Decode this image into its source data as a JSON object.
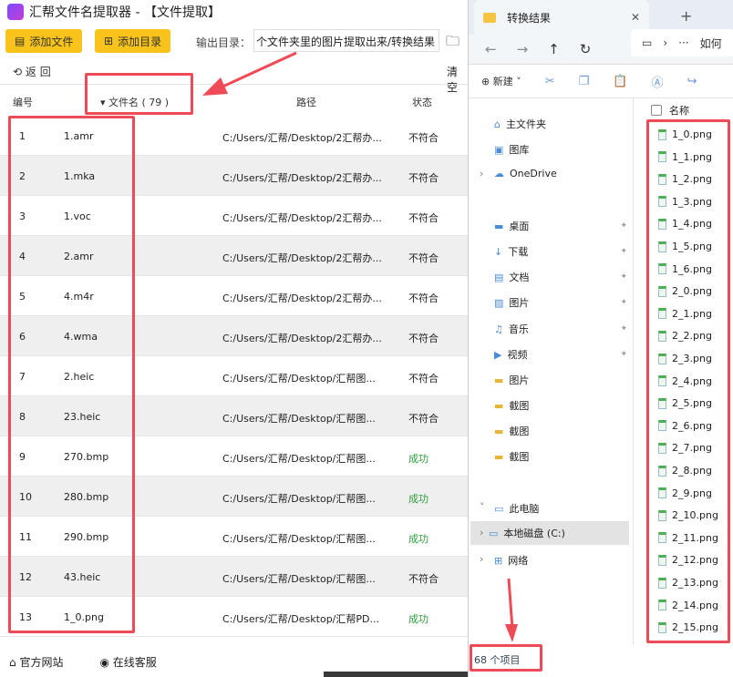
{
  "app": {
    "title": "汇帮文件名提取器 - 【文件提取】",
    "add_file": "添加文件",
    "add_dir": "添加目录",
    "output_label": "输出目录：",
    "output_value": "个文件夹里的图片提取出来/转换结果",
    "back": "返 回",
    "clear": "清空",
    "headers": {
      "num": "编号",
      "name": "▾ 文件名 ( 79 )",
      "path": "路径",
      "status": "状态"
    },
    "rows": [
      {
        "n": "1",
        "name": "1.amr",
        "path": "C:/Users/汇帮/Desktop/2汇帮办...",
        "status": "不符合"
      },
      {
        "n": "2",
        "name": "1.mka",
        "path": "C:/Users/汇帮/Desktop/2汇帮办...",
        "status": "不符合"
      },
      {
        "n": "3",
        "name": "1.voc",
        "path": "C:/Users/汇帮/Desktop/2汇帮办...",
        "status": "不符合"
      },
      {
        "n": "4",
        "name": "2.amr",
        "path": "C:/Users/汇帮/Desktop/2汇帮办...",
        "status": "不符合"
      },
      {
        "n": "5",
        "name": "4.m4r",
        "path": "C:/Users/汇帮/Desktop/2汇帮办...",
        "status": "不符合"
      },
      {
        "n": "6",
        "name": "4.wma",
        "path": "C:/Users/汇帮/Desktop/2汇帮办...",
        "status": "不符合"
      },
      {
        "n": "7",
        "name": "2.heic",
        "path": "C:/Users/汇帮/Desktop/汇帮图...",
        "status": "不符合"
      },
      {
        "n": "8",
        "name": "23.heic",
        "path": "C:/Users/汇帮/Desktop/汇帮图...",
        "status": "不符合"
      },
      {
        "n": "9",
        "name": "270.bmp",
        "path": "C:/Users/汇帮/Desktop/汇帮图...",
        "status": "成功"
      },
      {
        "n": "10",
        "name": "280.bmp",
        "path": "C:/Users/汇帮/Desktop/汇帮图...",
        "status": "成功"
      },
      {
        "n": "11",
        "name": "290.bmp",
        "path": "C:/Users/汇帮/Desktop/汇帮图...",
        "status": "成功"
      },
      {
        "n": "12",
        "name": "43.heic",
        "path": "C:/Users/汇帮/Desktop/汇帮图...",
        "status": "不符合"
      },
      {
        "n": "13",
        "name": "1_0.png",
        "path": "C:/Users/汇帮/Desktop/汇帮PD...",
        "status": "成功"
      }
    ],
    "footer": {
      "site": "官方网站",
      "support": "在线客服"
    }
  },
  "explorer": {
    "tab": "转换结果",
    "address": "如何",
    "new": "新建",
    "col_name": "名称",
    "sidebar": [
      {
        "label": "主文件夹",
        "icon": "home-icon",
        "pin": false
      },
      {
        "label": "图库",
        "icon": "gallery-icon",
        "pin": false
      },
      {
        "label": "OneDrive",
        "icon": "cloud-icon",
        "pin": false
      },
      {
        "label": "桌面",
        "icon": "desktop-icon",
        "pin": true
      },
      {
        "label": "下载",
        "icon": "download-icon",
        "pin": true
      },
      {
        "label": "文档",
        "icon": "document-icon",
        "pin": true
      },
      {
        "label": "图片",
        "icon": "picture-icon",
        "pin": true
      },
      {
        "label": "音乐",
        "icon": "music-icon",
        "pin": true
      },
      {
        "label": "视频",
        "icon": "video-icon",
        "pin": true
      },
      {
        "label": "图片",
        "icon": "folder-icon",
        "pin": false
      },
      {
        "label": "截图",
        "icon": "folder-icon",
        "pin": false
      },
      {
        "label": "截图",
        "icon": "folder-icon",
        "pin": false
      },
      {
        "label": "截图",
        "icon": "folder-icon",
        "pin": false
      },
      {
        "label": "此电脑",
        "icon": "pc-icon",
        "pin": false
      },
      {
        "label": "本地磁盘 (C:)",
        "icon": "drive-icon",
        "pin": false
      },
      {
        "label": "网络",
        "icon": "network-icon",
        "pin": false
      }
    ],
    "files": [
      "1_0.png",
      "1_1.png",
      "1_2.png",
      "1_3.png",
      "1_4.png",
      "1_5.png",
      "1_6.png",
      "2_0.png",
      "2_1.png",
      "2_2.png",
      "2_3.png",
      "2_4.png",
      "2_5.png",
      "2_6.png",
      "2_7.png",
      "2_8.png",
      "2_9.png",
      "2_10.png",
      "2_11.png",
      "2_12.png",
      "2_13.png",
      "2_14.png",
      "2_15.png"
    ],
    "status": "68 个项目"
  },
  "colors": {
    "accent": "#f8c31a",
    "highlight": "#ee4b57",
    "success": "#2e9e3a"
  }
}
